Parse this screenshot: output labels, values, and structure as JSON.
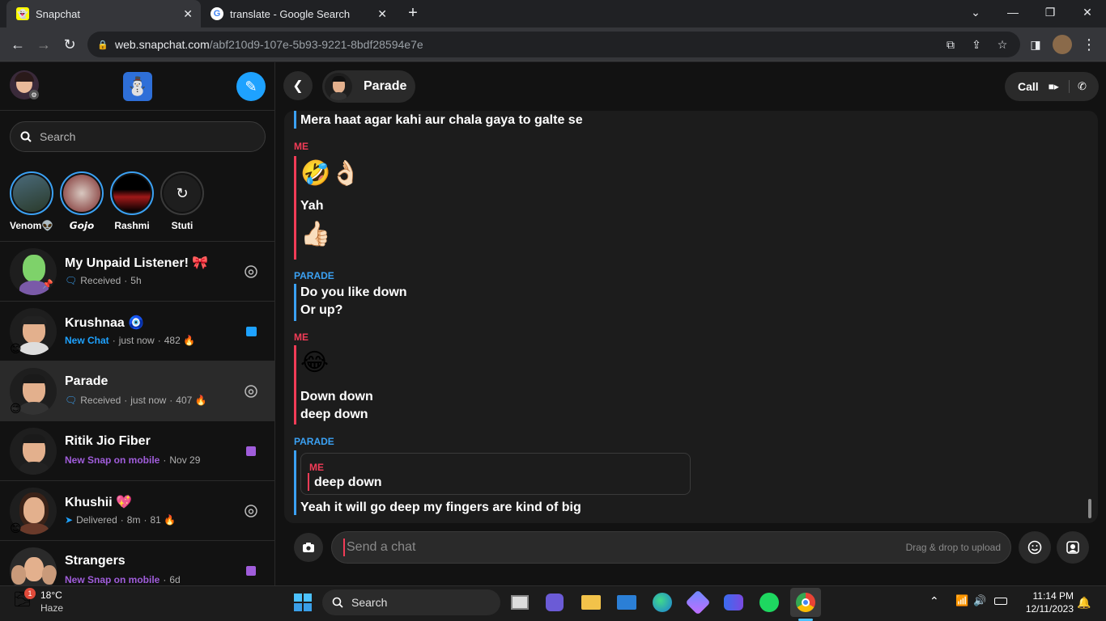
{
  "browser": {
    "tabs": [
      {
        "title": "Snapchat",
        "active": true
      },
      {
        "title": "translate - Google Search",
        "active": false
      }
    ],
    "url_host": "web.snapchat.com",
    "url_path": "/abf210d9-107e-5b93-9221-8bdf28594e7e"
  },
  "sidebar": {
    "search_placeholder": "Search",
    "stories": [
      {
        "name": "Venom👽"
      },
      {
        "name": "𝙂𝙤𝙟𝙤"
      },
      {
        "name": "Rashmi"
      },
      {
        "name": "Stuti"
      }
    ],
    "chats": [
      {
        "name": "My Unpaid Listener! 🎀",
        "status": "Received",
        "time": "5h",
        "streak": ""
      },
      {
        "name": "Krushnaa 🧿",
        "status": "New Chat",
        "time": "just now",
        "streak": "482 🔥"
      },
      {
        "name": "Parade",
        "status": "Received",
        "time": "just now",
        "streak": "407 🔥"
      },
      {
        "name": "Ritik Jio Fiber",
        "status": "New Snap on mobile",
        "time": "Nov 29",
        "streak": ""
      },
      {
        "name": "Khushii 💖",
        "status": "Delivered",
        "time": "8m",
        "streak": "81 🔥"
      },
      {
        "name": "Strangers",
        "status": "New Snap on mobile",
        "time": "6d",
        "streak": ""
      }
    ]
  },
  "chat": {
    "title": "Parade",
    "call_label": "Call",
    "messages": {
      "m0": "Mera haat agar kahi aur chala gaya to galte se",
      "s1": "ME",
      "e1": "🤣👌🏻",
      "m1": "Yah",
      "e2": "👍🏻",
      "s2": "PARADE",
      "m2": "Do you like down",
      "m3": "Or up?",
      "s3": "ME",
      "e3": "😂",
      "m4": "Down down",
      "m5": "deep down",
      "s4": "PARADE",
      "q_sender": "ME",
      "q_text": "deep down",
      "m6": "Yeah it will go deep my fingers are kind of big"
    },
    "composer_placeholder": "Send a chat",
    "drag_drop": "Drag & drop to upload"
  },
  "taskbar": {
    "weather_temp": "18°C",
    "weather_desc": "Haze",
    "weather_badge": "1",
    "search_label": "Search",
    "time": "11:14 PM",
    "date": "12/11/2023"
  },
  "colors": {
    "accent_blue": "#3ba1f3",
    "accent_red": "#f23c57",
    "purple": "#a05ddb",
    "snap_yellow": "#fffc00"
  }
}
